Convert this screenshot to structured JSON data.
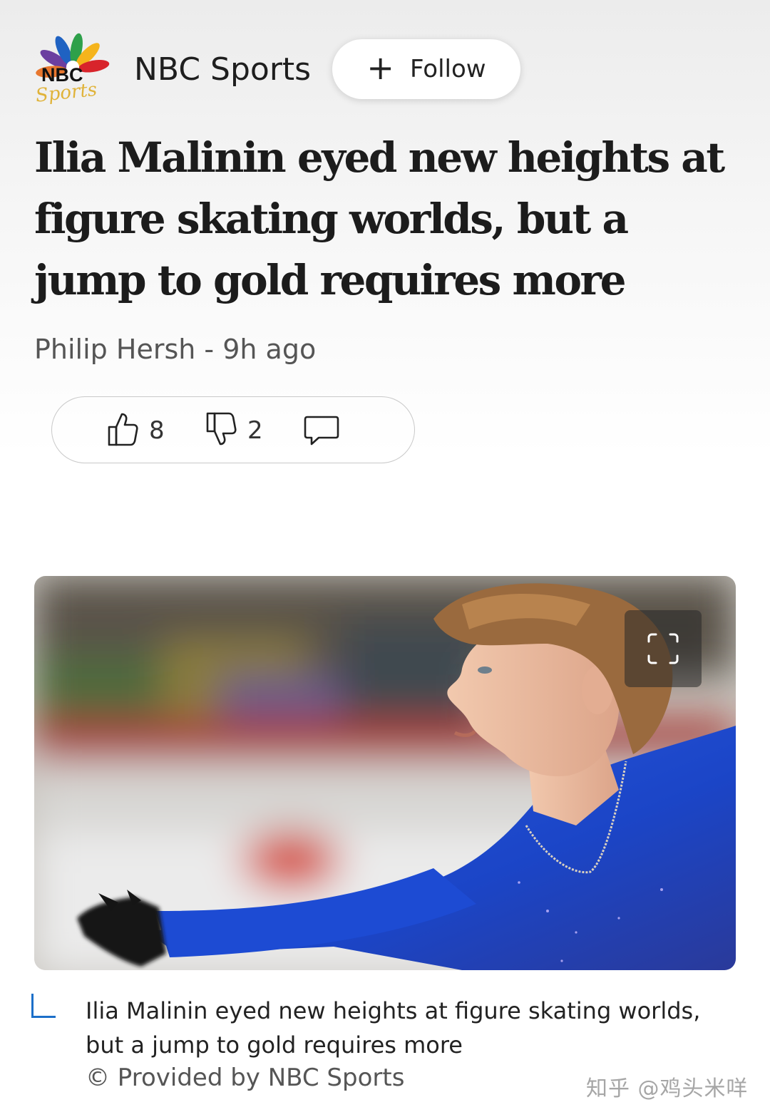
{
  "source": {
    "logo_text": "NBC Sports",
    "name": "NBC Sports",
    "follow_plus": "+",
    "follow_label": "Follow"
  },
  "article": {
    "headline": "Ilia Malinin eyed new heights at figure skating worlds, but a jump to gold requires more",
    "byline": "Philip Hersh - 9h ago"
  },
  "reactions": {
    "likes": "8",
    "dislikes": "2"
  },
  "image": {
    "caption": "Ilia Malinin eyed new heights at figure skating worlds, but a jump to gold requires more",
    "credit": "© Provided by NBC Sports"
  },
  "watermark": "知乎 @鸡头米咩",
  "colors": {
    "accent": "#1c6fc9",
    "shirt_blue": "#1f4fd6"
  },
  "icons": {
    "like": "thumbs-up-icon",
    "dislike": "thumbs-down-icon",
    "comment": "comment-icon",
    "expand": "fullscreen-icon",
    "follow": "plus-icon"
  }
}
